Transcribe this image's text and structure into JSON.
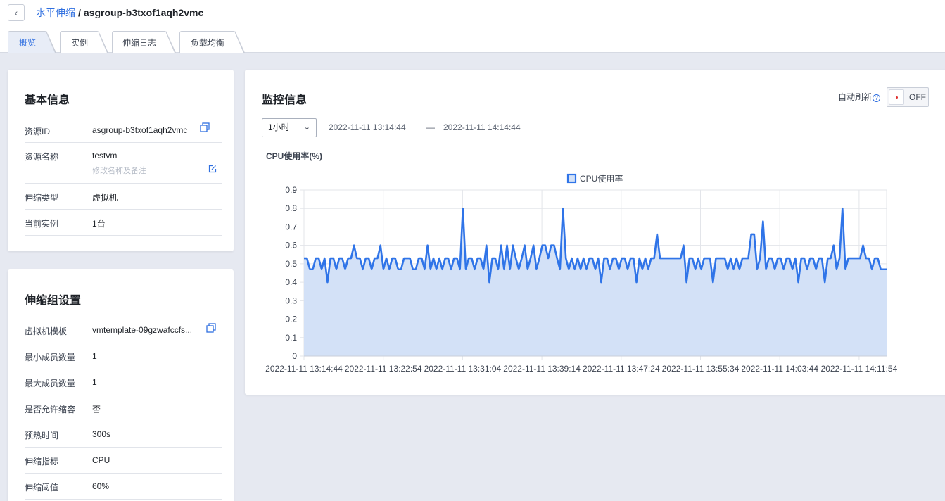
{
  "header": {
    "back_icon": "chevron-left-icon",
    "breadcrumb_parent": "水平伸缩",
    "breadcrumb_sep": "/",
    "breadcrumb_current": "asgroup-b3txof1aqh2vmc"
  },
  "tabs": [
    {
      "label": "概览",
      "active": true
    },
    {
      "label": "实例",
      "active": false
    },
    {
      "label": "伸缩日志",
      "active": false
    },
    {
      "label": "负载均衡",
      "active": false
    }
  ],
  "basic_info": {
    "title": "基本信息",
    "rows": [
      {
        "key": "资源ID",
        "value": "asgroup-b3txof1aqh2vmc",
        "icon": "copy-icon"
      },
      {
        "key": "资源名称",
        "value": "testvm",
        "hint": "修改名称及备注",
        "icon": "edit-icon"
      },
      {
        "key": "伸缩类型",
        "value": "虚拟机"
      },
      {
        "key": "当前实例",
        "value": "1台"
      }
    ]
  },
  "group_settings": {
    "title": "伸缩组设置",
    "rows": [
      {
        "key": "虚拟机模板",
        "value": "vmtemplate-09gzwafccfs...",
        "icon": "copy-icon"
      },
      {
        "key": "最小成员数量",
        "value": "1"
      },
      {
        "key": "最大成员数量",
        "value": "1"
      },
      {
        "key": "是否允许缩容",
        "value": "否"
      },
      {
        "key": "预热时间",
        "value": "300s"
      },
      {
        "key": "伸缩指标",
        "value": "CPU"
      },
      {
        "key": "伸缩阈值",
        "value": "60%"
      }
    ]
  },
  "monitor": {
    "title": "监控信息",
    "auto_refresh_label": "自动刷新",
    "help_icon": "question-circle-icon",
    "toggle_state": "OFF",
    "range_value": "1小时",
    "start_time": "2022-11-11 13:14:44",
    "range_dash": "—",
    "end_time": "2022-11-11 14:14:44",
    "chart_heading": "CPU使用率(%)"
  },
  "colors": {
    "accent": "#2f6fe0",
    "line": "#2f74e8",
    "area": "#d3e1f7"
  },
  "chart_data": {
    "type": "area",
    "title": "CPU使用率(%)",
    "legend": [
      "CPU使用率"
    ],
    "legend_position": "top-center",
    "grid": true,
    "ylim": [
      0,
      0.9
    ],
    "yticks": [
      0,
      0.1,
      0.2,
      0.3,
      0.4,
      0.5,
      0.6,
      0.7,
      0.8,
      0.9
    ],
    "xtick_labels": [
      "2022-11-11 13:14:44",
      "2022-11-11 13:22:54",
      "2022-11-11 13:31:04",
      "2022-11-11 13:39:14",
      "2022-11-11 13:47:24",
      "2022-11-11 13:55:34",
      "2022-11-11 14:03:44",
      "2022-11-11 14:11:54"
    ],
    "x_start": "2022-11-11 13:14:44",
    "x_end": "2022-11-11 14:14:44",
    "series": [
      {
        "name": "CPU使用率",
        "values": [
          0.53,
          0.53,
          0.47,
          0.47,
          0.53,
          0.53,
          0.47,
          0.53,
          0.4,
          0.53,
          0.53,
          0.47,
          0.53,
          0.53,
          0.47,
          0.53,
          0.53,
          0.6,
          0.53,
          0.53,
          0.47,
          0.53,
          0.53,
          0.47,
          0.53,
          0.53,
          0.6,
          0.47,
          0.53,
          0.47,
          0.53,
          0.53,
          0.47,
          0.47,
          0.53,
          0.53,
          0.53,
          0.47,
          0.47,
          0.53,
          0.53,
          0.47,
          0.6,
          0.47,
          0.53,
          0.47,
          0.53,
          0.47,
          0.53,
          0.53,
          0.47,
          0.53,
          0.53,
          0.47,
          0.8,
          0.47,
          0.53,
          0.53,
          0.47,
          0.53,
          0.53,
          0.47,
          0.6,
          0.4,
          0.53,
          0.53,
          0.47,
          0.6,
          0.47,
          0.6,
          0.47,
          0.6,
          0.53,
          0.47,
          0.53,
          0.6,
          0.47,
          0.53,
          0.6,
          0.47,
          0.53,
          0.6,
          0.6,
          0.53,
          0.6,
          0.6,
          0.53,
          0.47,
          0.8,
          0.53,
          0.47,
          0.53,
          0.47,
          0.53,
          0.47,
          0.53,
          0.47,
          0.53,
          0.53,
          0.47,
          0.53,
          0.4,
          0.53,
          0.53,
          0.47,
          0.53,
          0.53,
          0.47,
          0.53,
          0.53,
          0.47,
          0.53,
          0.53,
          0.4,
          0.53,
          0.47,
          0.53,
          0.47,
          0.53,
          0.53,
          0.66,
          0.53,
          0.53,
          0.53,
          0.53,
          0.53,
          0.53,
          0.53,
          0.53,
          0.6,
          0.4,
          0.53,
          0.53,
          0.47,
          0.53,
          0.47,
          0.53,
          0.53,
          0.53,
          0.4,
          0.53,
          0.53,
          0.53,
          0.53,
          0.47,
          0.53,
          0.47,
          0.53,
          0.47,
          0.53,
          0.53,
          0.53,
          0.66,
          0.66,
          0.47,
          0.53,
          0.73,
          0.47,
          0.53,
          0.53,
          0.47,
          0.53,
          0.53,
          0.47,
          0.53,
          0.53,
          0.47,
          0.53,
          0.4,
          0.53,
          0.53,
          0.47,
          0.53,
          0.53,
          0.47,
          0.53,
          0.53,
          0.4,
          0.53,
          0.53,
          0.6,
          0.47,
          0.53,
          0.8,
          0.47,
          0.53,
          0.53,
          0.53,
          0.53,
          0.53,
          0.6,
          0.53,
          0.53,
          0.47,
          0.53,
          0.53,
          0.47,
          0.47,
          0.47
        ]
      }
    ]
  }
}
